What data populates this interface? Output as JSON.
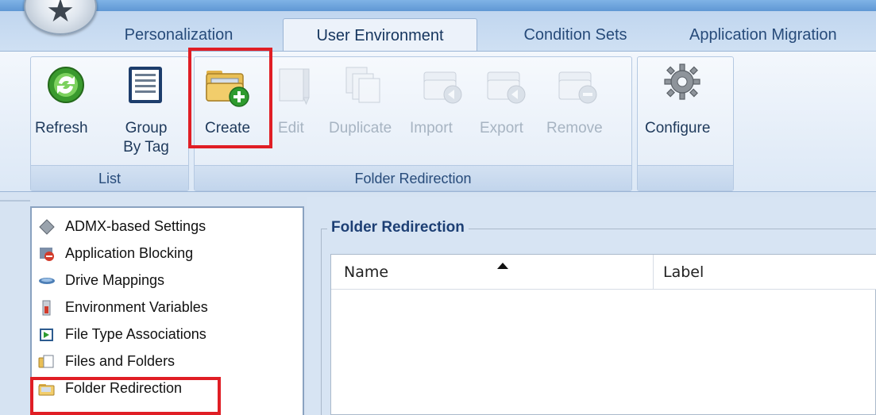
{
  "ribbon_tabs": [
    "Personalization",
    "User Environment",
    "Condition Sets",
    "Application Migration"
  ],
  "list_group": {
    "label": "List",
    "refresh": "Refresh",
    "group_by_tag_line1": "Group",
    "group_by_tag_line2": "By Tag"
  },
  "folder_group": {
    "label": "Folder Redirection",
    "create": "Create",
    "edit": "Edit",
    "duplicate": "Duplicate",
    "import": "Import",
    "export": "Export",
    "remove": "Remove"
  },
  "config_group": {
    "configure": "Configure"
  },
  "sidebar": {
    "items": [
      {
        "label": "ADMX-based Settings",
        "icon": "admx-icon"
      },
      {
        "label": "Application Blocking",
        "icon": "app-blocking-icon"
      },
      {
        "label": "Drive Mappings",
        "icon": "drive-icon"
      },
      {
        "label": "Environment Variables",
        "icon": "env-var-icon"
      },
      {
        "label": "File Type Associations",
        "icon": "file-type-icon"
      },
      {
        "label": "Files and Folders",
        "icon": "files-folders-icon"
      },
      {
        "label": "Folder Redirection",
        "icon": "folder-redirection-icon"
      }
    ]
  },
  "main": {
    "title": "Folder Redirection",
    "columns": [
      "Name",
      "Label"
    ]
  },
  "colors": {
    "highlight": "#e01e25",
    "accent": "#1d3f74"
  }
}
